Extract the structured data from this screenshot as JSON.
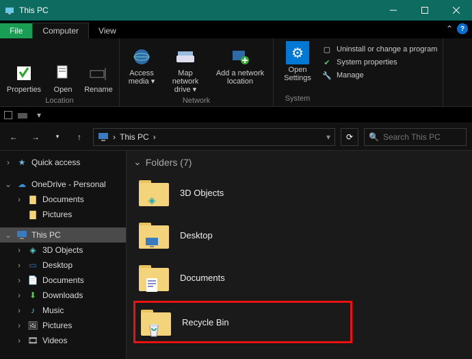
{
  "title": "This PC",
  "tabs": {
    "file": "File",
    "computer": "Computer",
    "view": "View"
  },
  "ribbon": {
    "location": {
      "label": "Location",
      "properties": "Properties",
      "open": "Open",
      "rename": "Rename"
    },
    "network": {
      "label": "Network",
      "access_media": "Access media ▾",
      "map_drive": "Map network drive ▾",
      "add_location": "Add a network location"
    },
    "system": {
      "label": "System",
      "open_settings": "Open Settings",
      "uninstall": "Uninstall or change a program",
      "sysprops": "System properties",
      "manage": "Manage"
    }
  },
  "breadcrumb": {
    "root": "This PC",
    "sep": "›"
  },
  "search": {
    "placeholder": "Search This PC"
  },
  "sidebar": {
    "quick_access": "Quick access",
    "onedrive": "OneDrive - Personal",
    "onedrive_children": [
      "Documents",
      "Pictures"
    ],
    "this_pc": "This PC",
    "this_pc_children": [
      "3D Objects",
      "Desktop",
      "Documents",
      "Downloads",
      "Music",
      "Pictures",
      "Videos"
    ]
  },
  "content": {
    "header": "Folders (7)",
    "items": [
      {
        "label": "3D Objects"
      },
      {
        "label": "Desktop"
      },
      {
        "label": "Documents"
      },
      {
        "label": "Recycle Bin"
      }
    ]
  },
  "icons": {
    "pc": "🖥",
    "star": "★",
    "cloud": "☁",
    "folder": "📁",
    "downloads": "⬇",
    "music": "♪",
    "pictures": "🖼",
    "videos": "🎞",
    "3d": "◈",
    "desktop": "▭",
    "docs": "📄",
    "bin": "🗑",
    "search": "🔍",
    "refresh": "⟳",
    "back": "←",
    "fwd": "→",
    "up": "↑",
    "down": "▾",
    "check": "✔",
    "settings": "⚙",
    "shield": "🛡",
    "box": "▢",
    "wrench": "🔧",
    "caret_up": "⌃",
    "question": "?"
  }
}
